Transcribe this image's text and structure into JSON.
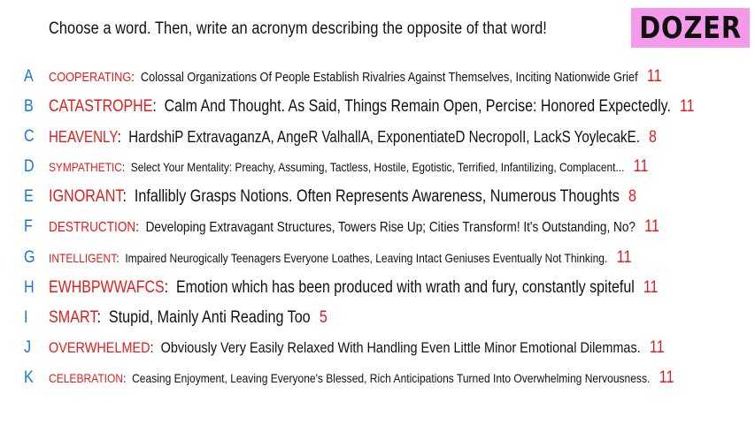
{
  "prompt": "Choose a word. Then, write an acronym describing the opposite of that word!",
  "logo": "DOZER",
  "entries": [
    {
      "letter": "A",
      "word": "COOPERATING",
      "acronym": "Colossal Organizations Of People Establish Rivalries Against Themselves, Inciting Nationwide Grief",
      "score": "11"
    },
    {
      "letter": "B",
      "word": "CATASTROPHE",
      "acronym": "Calm And Thought. As Said, Things Remain Open, Percise: Honored Expectedly.",
      "score": "11"
    },
    {
      "letter": "C",
      "word": "HEAVENLY",
      "acronym": "HardshiP ExtravaganzA, AngeR ValhallA, ExponentiateD NecropolI, LackS YoylecakE.",
      "score": "8"
    },
    {
      "letter": "D",
      "word": "SYMPATHETIC",
      "acronym": "Select Your Mentality: Preachy, Assuming, Tactless, Hostile, Egotistic, Terrified, Infantilizing, Complacent...",
      "score": "11"
    },
    {
      "letter": "E",
      "word": "IGNORANT",
      "acronym": "Infallibly Grasps Notions. Often Represents Awareness, Numerous Thoughts",
      "score": "8"
    },
    {
      "letter": "F",
      "word": "DESTRUCTION",
      "acronym": "Developing Extravagant Structures, Towers Rise Up; Cities Transform! It's Outstanding, No?",
      "score": "11"
    },
    {
      "letter": "G",
      "word": "INTELLIGENT",
      "acronym": "Impaired Neurogically Teenagers Everyone Loathes, Leaving Intact Geniuses Eventually Not Thinking.",
      "score": "11"
    },
    {
      "letter": "H",
      "word": "EWHBPWWAFCS",
      "acronym": "Emotion which has been produced with wrath and fury, constantly spiteful",
      "score": "11"
    },
    {
      "letter": "I",
      "word": "SMART",
      "acronym": "Stupid, Mainly Anti Reading Too",
      "score": "5"
    },
    {
      "letter": "J",
      "word": "OVERWHELMED",
      "acronym": "Obviously Very Easily Relaxed With Handling Even Little Minor Emotional Dilemmas.",
      "score": "11"
    },
    {
      "letter": "K",
      "word": "CELEBRATION",
      "acronym": "Ceasing Enjoyment, Leaving Everyone's Blessed, Rich Anticipations Turned Into Overwhelming Nervousness.",
      "score": "11"
    }
  ],
  "colors": {
    "letter": "#1a76d2",
    "word": "#e21d1d",
    "score": "#e21d1d",
    "logo_bg": "#f39bea"
  }
}
